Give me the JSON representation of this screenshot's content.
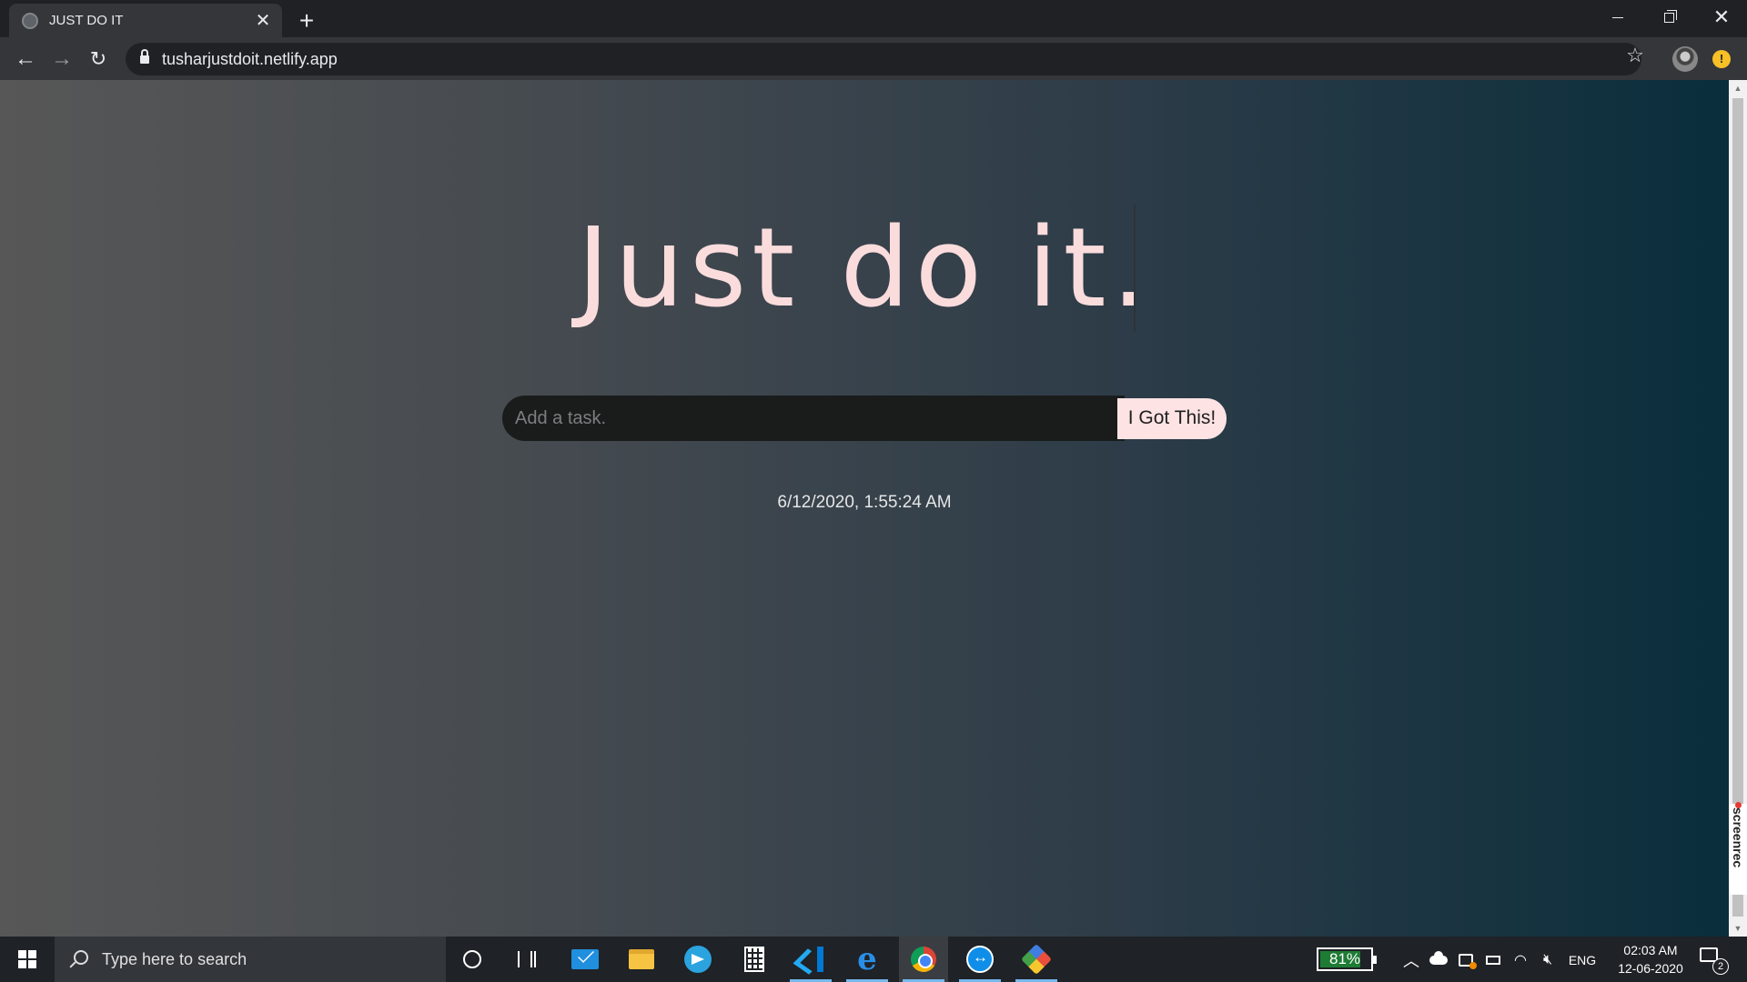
{
  "browser": {
    "tab_title": "JUST DO IT",
    "url": "tusharjustdoit.netlify.app"
  },
  "page": {
    "headline": "Just do it.",
    "task_input_placeholder": "Add a task.",
    "submit_label": "I Got This!",
    "datetime": "6/12/2020, 1:55:24 AM"
  },
  "overlay": {
    "recorder_badge": "screenrec"
  },
  "taskbar": {
    "search_placeholder": "Type here to search",
    "pinned": [
      "cortana-icon",
      "task-view-icon",
      "mail-icon",
      "file-explorer-icon",
      "telegram-icon",
      "calculator-icon",
      "vscode-icon",
      "edge-icon",
      "chrome-icon",
      "teamviewer-icon",
      "git-icon"
    ],
    "battery_percent": "81%",
    "battery_level": 0.81,
    "language": "ENG",
    "time": "02:03 AM",
    "date": "12-06-2020",
    "notification_count": "2"
  },
  "colors": {
    "headline": "#fbdcdc",
    "button_bg": "#fde3e3",
    "input_bg": "#1a1c1c",
    "battery_fill": "#1e7b34"
  }
}
